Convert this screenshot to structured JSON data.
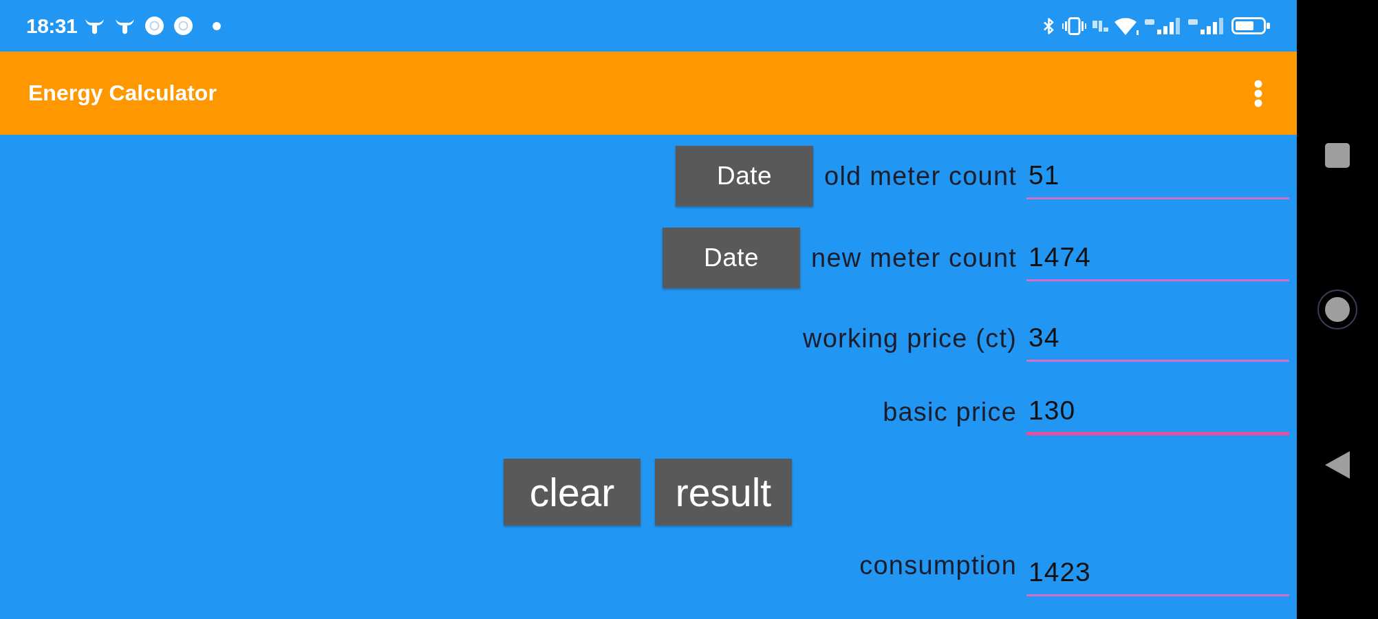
{
  "status_bar": {
    "time": "18:31"
  },
  "app_bar": {
    "title": "Energy Calculator"
  },
  "form": {
    "rows": [
      {
        "kind": "dated",
        "button": "Date",
        "label": "old meter count",
        "value": "51",
        "focused": false
      },
      {
        "kind": "dated",
        "button": "Date",
        "label": "new meter count",
        "value": "1474",
        "focused": false
      },
      {
        "kind": "plain",
        "label": "working price (ct)",
        "value": "34",
        "focused": false
      },
      {
        "kind": "plain",
        "label": "basic price",
        "value": "130",
        "focused": true
      }
    ],
    "actions": [
      "clear",
      "result"
    ],
    "result": {
      "label": "consumption",
      "value": "1423"
    }
  }
}
